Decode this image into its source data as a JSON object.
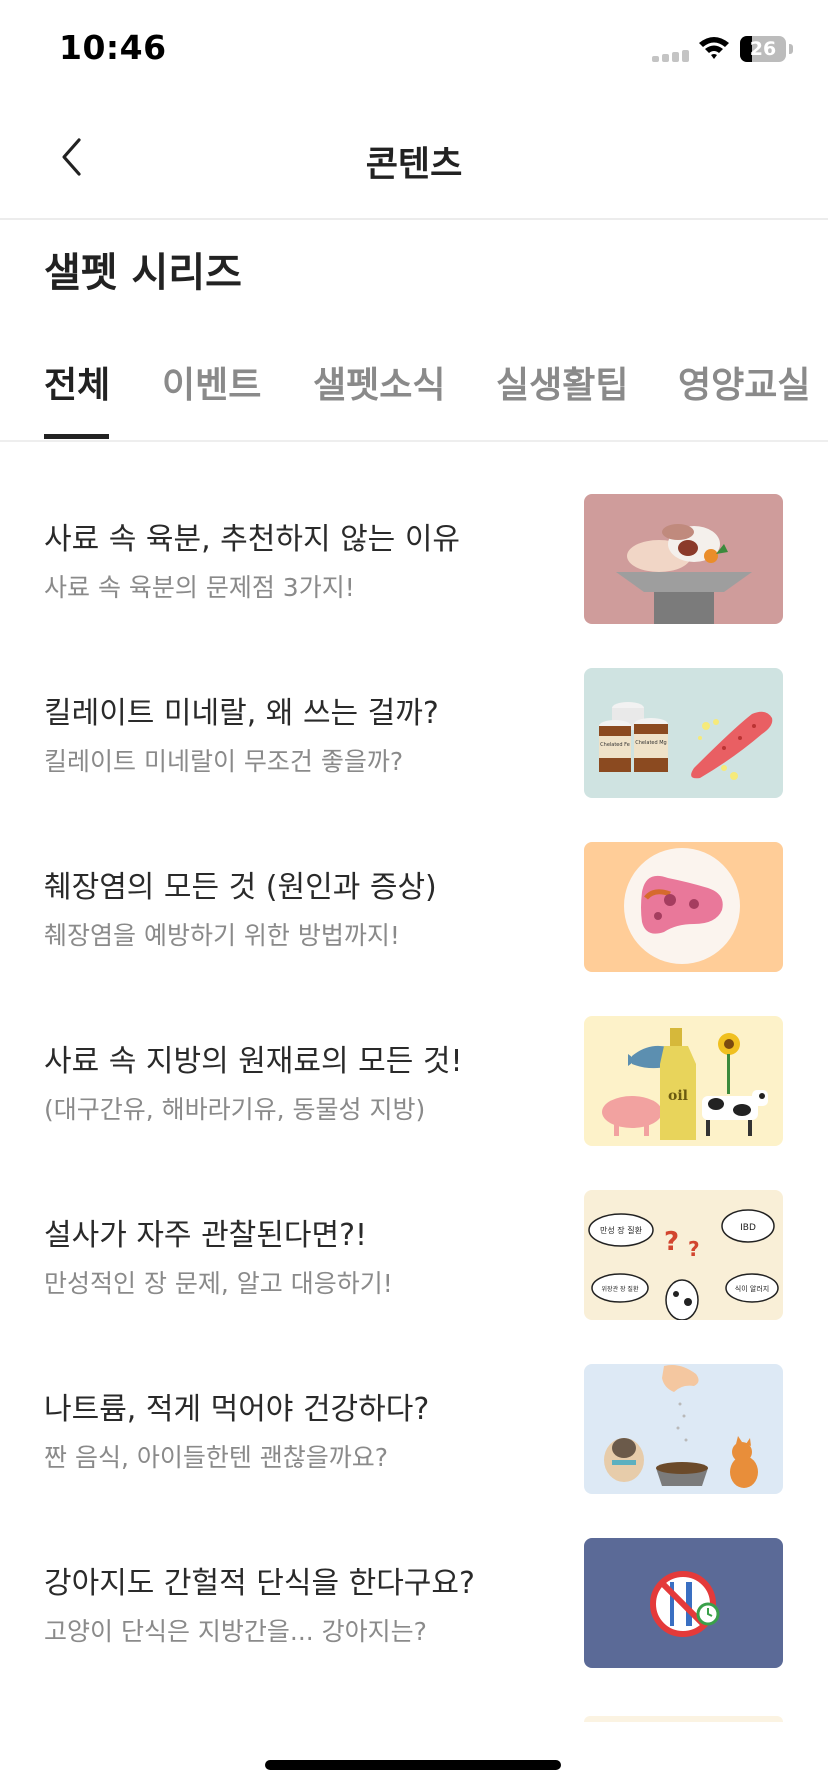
{
  "status_bar": {
    "time": "10:46",
    "battery": "26",
    "battery_level": 0.26
  },
  "nav": {
    "title": "콘텐츠",
    "back_icon": "chevron-left-icon"
  },
  "section": {
    "title": "샐펫 시리즈"
  },
  "tabs": [
    {
      "label": "전체",
      "active": true
    },
    {
      "label": "이벤트",
      "active": false
    },
    {
      "label": "샐펫소식",
      "active": false
    },
    {
      "label": "실생활팁",
      "active": false
    },
    {
      "label": "영양교실",
      "active": false
    }
  ],
  "articles": [
    {
      "title": "사료 속 육분, 추천하지 않는 이유",
      "subtitle": "사료 속 육분의 문제점 3가지!",
      "thumb_bg": "#cf9c9b"
    },
    {
      "title": "킬레이트 미네랄, 왜 쓰는 걸까?",
      "subtitle": "킬레이트 미네랄이 무조건 좋을까?",
      "thumb_bg": "#cfe3e1",
      "thumb_text": [
        "Chelated Fe",
        "Chelated Mg"
      ]
    },
    {
      "title": "췌장염의 모든 것 (원인과 증상)",
      "subtitle": "췌장염을 예방하기 위한 방법까지!",
      "thumb_bg": "#ffcd98"
    },
    {
      "title": "사료 속 지방의 원재료의 모든 것!",
      "subtitle": "(대구간유, 해바라기유, 동물성 지방)",
      "thumb_bg": "#fdf2c9",
      "thumb_text": [
        "oil"
      ]
    },
    {
      "title": "설사가 자주 관찰된다면?!",
      "subtitle": "만성적인 장 문제, 알고 대응하기!",
      "thumb_bg": "#f9efd7",
      "thumb_text": [
        "만성 장 질환",
        "IBD",
        "위장관 장 질환",
        "식이 알러지"
      ]
    },
    {
      "title": "나트륨, 적게 먹어야 건강하다?",
      "subtitle": "짠 음식, 아이들한텐 괜찮을까요?",
      "thumb_bg": "#dde9f5"
    },
    {
      "title": "강아지도 간헐적 단식을 한다구요?",
      "subtitle": "고양이 단식은 지방간을... 강아지는?",
      "thumb_bg": "#5b6a97"
    }
  ],
  "colors": {
    "active_tab": "#222222",
    "inactive_tab": "#8a8a8a",
    "subtitle": "#8a8a8a"
  }
}
